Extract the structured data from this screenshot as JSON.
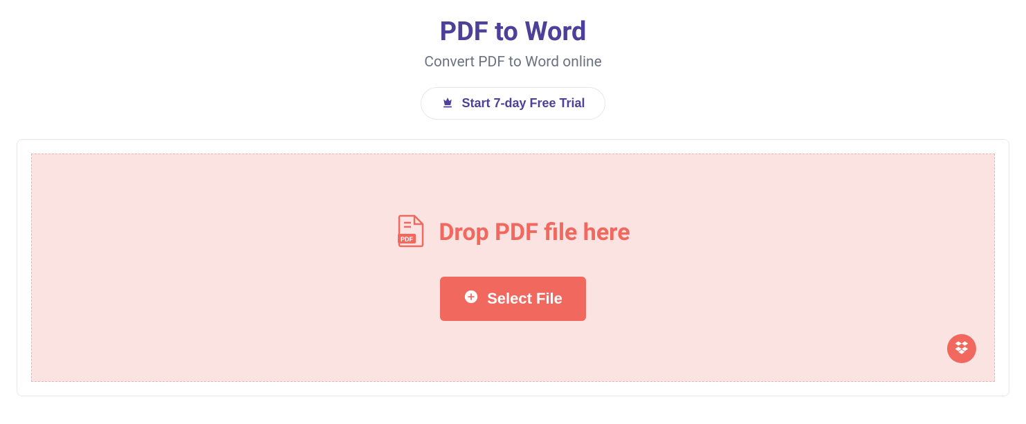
{
  "header": {
    "title": "PDF to Word",
    "subtitle": "Convert PDF to Word online",
    "trial_label": "Start 7-day Free Trial"
  },
  "dropzone": {
    "drop_text": "Drop PDF file here",
    "pdf_badge": "PDF",
    "select_label": "Select File"
  }
}
